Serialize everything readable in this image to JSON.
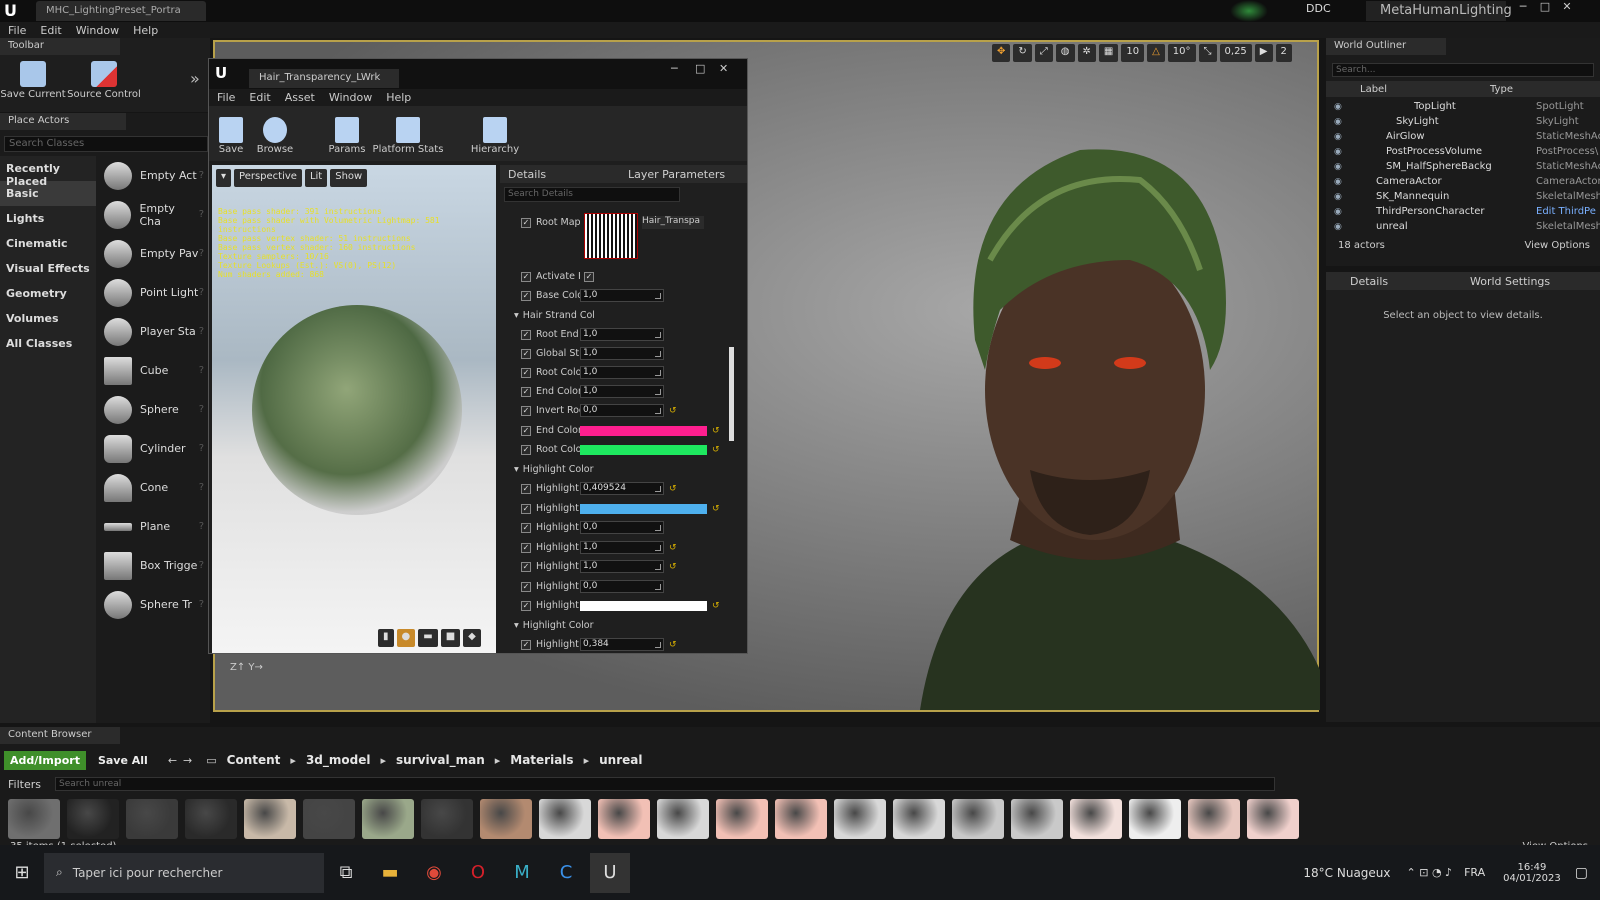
{
  "title_bar": {
    "tab_title": "MHC_LightingPreset_Portra",
    "ddc": "DDC",
    "project": "MetaHumanLighting"
  },
  "menu": [
    "File",
    "Edit",
    "Window",
    "Help"
  ],
  "toolbar": {
    "tab": "Toolbar",
    "save": "Save Current",
    "source": "Source Control"
  },
  "place_actors": {
    "tab": "Place Actors",
    "search_placeholder": "Search Classes",
    "categories": [
      "Recently Placed",
      "Basic",
      "Lights",
      "Cinematic",
      "Visual Effects",
      "Geometry",
      "Volumes",
      "All Classes"
    ],
    "items": [
      "Empty Act",
      "Empty Cha",
      "Empty Pav",
      "Point Light",
      "Player Sta",
      "Cube",
      "Sphere",
      "Cylinder",
      "Cone",
      "Plane",
      "Box Trigge",
      "Sphere Tr"
    ]
  },
  "viewport": {
    "snap_grid": "10",
    "snap_rot": "10°",
    "snap_scale": "0,25",
    "camera_speed": "2"
  },
  "material_editor": {
    "tab": "Hair_Transparency_LWrk",
    "menu": [
      "File",
      "Edit",
      "Asset",
      "Window",
      "Help"
    ],
    "tools": [
      "Save",
      "Browse",
      "Params",
      "Platform Stats",
      "Hierarchy"
    ],
    "viewport": {
      "mode": "Perspective",
      "lit": "Lit",
      "show": "Show"
    },
    "stats": [
      "Base pass shader: 391 instructions",
      "Base pass shader with Volumetric Lightmap: 581 instructions",
      "Base pass vertex shader: 51 instructions",
      "Base pass vertex shader: 160 instructions",
      "Texture samplers: 10/16",
      "Texture Lookups (Est.): VS(0), PS(12)",
      "Num shaders added: 868"
    ],
    "details_tab": "Details",
    "layer_tab": "Layer Parameters",
    "search_placeholder": "Search Details",
    "root_map_label": "Root Map",
    "root_map_asset": "Hair_Transpa",
    "rows_top": [
      {
        "label": "Activate H",
        "value": "✓"
      },
      {
        "label": "Base Colo",
        "value": "1,0"
      }
    ],
    "section_strand": "Hair Strand Col",
    "rows_strand": [
      {
        "label": "Root End E",
        "value": "1,0"
      },
      {
        "label": "Global Str",
        "value": "1,0"
      },
      {
        "label": "Root Color",
        "value": "1,0"
      },
      {
        "label": "End Color",
        "value": "1,0"
      },
      {
        "label": "Invert Roo",
        "value": "0,0"
      }
    ],
    "end_color_label": "End Color",
    "end_color": "#ff1f8f",
    "root_color_label": "Root Colo",
    "root_color": "#1ee85f",
    "section_highlight": "Highlight Color",
    "rows_highlight": [
      {
        "label": "Highlight /",
        "value": "0,409524"
      },
      {
        "label": "Highlight /",
        "value": "0,0"
      },
      {
        "label": "Highlight /",
        "value": "1,0"
      },
      {
        "label": "Highlight /",
        "value": "1,0"
      },
      {
        "label": "Highlight /",
        "value": "0,0"
      }
    ],
    "highlight_color_label": "Highlight",
    "highlight_color": "#4eb0ee",
    "highlight_white_label": "Highlight",
    "highlight_white": "#ffffff",
    "section_highlight2": "Highlight Color",
    "row_last": {
      "label": "Highlight E",
      "value": "0,384"
    }
  },
  "outliner": {
    "tab": "World Outliner",
    "search_placeholder": "Search...",
    "col_label": "Label",
    "col_type": "Type",
    "rows": [
      {
        "label": "TopLight",
        "type": "SpotLight"
      },
      {
        "label": "SkyLight",
        "type": "SkyLight"
      },
      {
        "label": "AirGlow",
        "type": "StaticMeshAc"
      },
      {
        "label": "PostProcessVolume",
        "type": "PostProcess\\"
      },
      {
        "label": "SM_HalfSphereBackg",
        "type": "StaticMeshAc"
      },
      {
        "label": "CameraActor",
        "type": "CameraActor"
      },
      {
        "label": "SK_Mannequin",
        "type": "SkeletalMesh"
      },
      {
        "label": "ThirdPersonCharacter",
        "type": "Edit ThirdPe"
      },
      {
        "label": "unreal",
        "type": "SkeletalMesh"
      }
    ],
    "count": "18 actors",
    "view_options": "View Options"
  },
  "details_right": {
    "tab": "Details",
    "world_tab": "World Settings",
    "empty": "Select an object to view details."
  },
  "content_browser": {
    "tab": "Content Browser",
    "add_import": "Add/Import",
    "save_all": "Save All",
    "path": [
      "Content",
      "3d_model",
      "survival_man",
      "Materials",
      "unreal"
    ],
    "filters": "Filters",
    "search_placeholder": "Search unreal",
    "status": "35 items (1 selected)",
    "view_options": "View Options"
  },
  "taskbar": {
    "search": "Taper ici pour rechercher",
    "weather": "18°C  Nuageux",
    "lang": "FRA",
    "time": "16:49",
    "date": "04/01/2023"
  }
}
